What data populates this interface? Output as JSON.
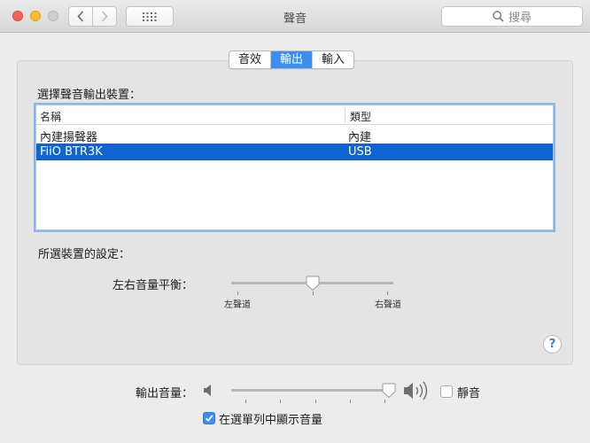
{
  "window": {
    "title": "聲音"
  },
  "toolbar": {
    "search_placeholder": "搜尋"
  },
  "tabs": [
    {
      "label": "音效",
      "active": false
    },
    {
      "label": "輸出",
      "active": true
    },
    {
      "label": "輸入",
      "active": false
    }
  ],
  "output": {
    "heading": "選擇聲音輸出裝置：",
    "columns": {
      "name": "名稱",
      "type": "類型"
    },
    "devices": [
      {
        "name": "內建揚聲器",
        "type": "內建",
        "selected": false
      },
      {
        "name": "FiiO BTR3K",
        "type": "USB",
        "selected": true
      }
    ],
    "settings_heading": "所選裝置的設定：",
    "balance_label": "左右音量平衡：",
    "balance_left": "左聲道",
    "balance_right": "右聲道",
    "balance_value": 0.5
  },
  "footer": {
    "volume_label": "輸出音量：",
    "volume_value": 0.97,
    "mute_label": "靜音",
    "mute_checked": false,
    "show_in_menubar_label": "在選單列中顯示音量",
    "show_in_menubar_checked": true
  },
  "colors": {
    "accent": "#3b8ef1",
    "selection": "#0f64d2"
  }
}
